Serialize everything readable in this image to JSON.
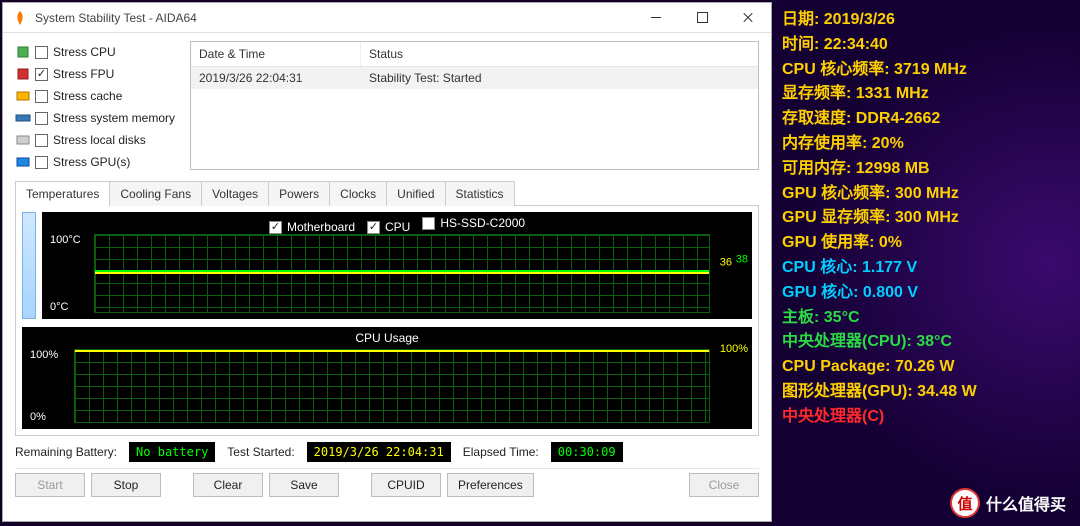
{
  "window": {
    "title": "System Stability Test - AIDA64"
  },
  "stress": [
    {
      "label": "Stress CPU",
      "checked": false,
      "icon": "cpu-small-icon"
    },
    {
      "label": "Stress FPU",
      "checked": true,
      "icon": "fpu-small-icon"
    },
    {
      "label": "Stress cache",
      "checked": false,
      "icon": "cache-small-icon"
    },
    {
      "label": "Stress system memory",
      "checked": false,
      "icon": "ram-small-icon"
    },
    {
      "label": "Stress local disks",
      "checked": false,
      "icon": "disk-small-icon"
    },
    {
      "label": "Stress GPU(s)",
      "checked": false,
      "icon": "gpu-small-icon"
    }
  ],
  "log": {
    "headers": {
      "datetime": "Date & Time",
      "status": "Status"
    },
    "rows": [
      {
        "datetime": "2019/3/26 22:04:31",
        "status": "Stability Test: Started"
      }
    ]
  },
  "tabs": [
    "Temperatures",
    "Cooling Fans",
    "Voltages",
    "Powers",
    "Clocks",
    "Unified",
    "Statistics"
  ],
  "active_tab": 0,
  "temp_chart": {
    "series": [
      {
        "name": "Motherboard",
        "checked": true
      },
      {
        "name": "CPU",
        "checked": true
      },
      {
        "name": "HS-SSD-C2000",
        "checked": false
      }
    ],
    "y_top": "100°C",
    "y_bot": "0°C",
    "r1": "36",
    "r2": "38"
  },
  "cpu_chart": {
    "title": "CPU Usage",
    "y_top": "100%",
    "y_bot": "0%",
    "r": "100%"
  },
  "status": {
    "battery_label": "Remaining Battery:",
    "battery_value": "No battery",
    "started_label": "Test Started:",
    "started_value": "2019/3/26 22:04:31",
    "elapsed_label": "Elapsed Time:",
    "elapsed_value": "00:30:09"
  },
  "buttons": {
    "start": "Start",
    "stop": "Stop",
    "clear": "Clear",
    "save": "Save",
    "cpuid": "CPUID",
    "prefs": "Preferences",
    "close": "Close"
  },
  "stats": [
    {
      "label": "日期: ",
      "value": "2019/3/26",
      "cls": "c-yellow"
    },
    {
      "label": "时间: ",
      "value": "22:34:40",
      "cls": "c-yellow"
    },
    {
      "label": "CPU 核心频率: ",
      "value": "3719 MHz",
      "cls": "c-yellow"
    },
    {
      "label": "显存频率: ",
      "value": "1331 MHz",
      "cls": "c-yellow"
    },
    {
      "label": "存取速度: ",
      "value": "DDR4-2662",
      "cls": "c-yellow"
    },
    {
      "label": "内存使用率: ",
      "value": "20%",
      "cls": "c-yellow"
    },
    {
      "label": "可用内存: ",
      "value": "12998 MB",
      "cls": "c-yellow"
    },
    {
      "label": "GPU 核心频率: ",
      "value": "300 MHz",
      "cls": "c-yellow"
    },
    {
      "label": "GPU 显存频率: ",
      "value": "300 MHz",
      "cls": "c-yellow"
    },
    {
      "label": "GPU 使用率: ",
      "value": "0%",
      "cls": "c-yellow"
    },
    {
      "label": "CPU 核心: ",
      "value": "1.177 V",
      "cls": "c-cyan"
    },
    {
      "label": "GPU 核心: ",
      "value": "0.800 V",
      "cls": "c-cyan"
    },
    {
      "label": "主板: ",
      "value": "35°C",
      "cls": "c-green"
    },
    {
      "label": "中央处理器(CPU): ",
      "value": "38°C",
      "cls": "c-green"
    },
    {
      "label": "CPU Package: ",
      "value": "70.26 W",
      "cls": "c-yellow"
    },
    {
      "label": "图形处理器(GPU): ",
      "value": "34.48 W",
      "cls": "c-yellow"
    },
    {
      "label": "中央处理器(C",
      "value": ")",
      "cls": "c-red"
    }
  ],
  "watermark": {
    "badge": "值",
    "text": "什么值得买"
  },
  "chart_data": [
    {
      "type": "line",
      "title": "Temperatures",
      "ylabel": "°C",
      "ylim": [
        0,
        100
      ],
      "x_minutes": [
        0,
        30
      ],
      "series": [
        {
          "name": "Motherboard",
          "values_flat": 36
        },
        {
          "name": "CPU",
          "values_flat": 38
        }
      ]
    },
    {
      "type": "line",
      "title": "CPU Usage",
      "ylabel": "%",
      "ylim": [
        0,
        100
      ],
      "x_minutes": [
        0,
        30
      ],
      "series": [
        {
          "name": "CPU Usage",
          "values_flat": 100
        }
      ]
    }
  ]
}
